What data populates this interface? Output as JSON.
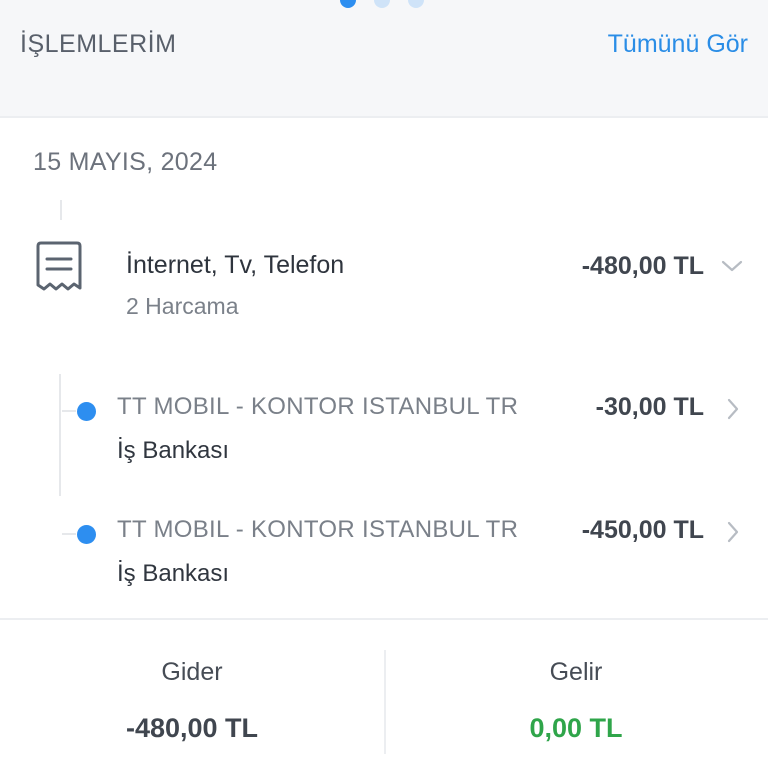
{
  "header": {
    "title": "İŞLEMLERİM",
    "see_all_label": "Tümünü Gör",
    "pager": {
      "count": 3,
      "active_index": 0
    }
  },
  "date": "15 MAYIS, 2024",
  "category": {
    "icon": "receipt-icon",
    "title": "İnternet, Tv, Telefon",
    "subtitle": "2 Harcama",
    "amount": "-480,00 TL",
    "expand_icon": "chevron-down-icon"
  },
  "transactions": [
    {
      "merchant": "TT MOBIL - KONTOR ISTANBUL TR",
      "bank": "İş Bankası",
      "amount": "-30,00 TL"
    },
    {
      "merchant": "TT MOBIL - KONTOR ISTANBUL TR",
      "bank": "İş Bankası",
      "amount": "-450,00 TL"
    }
  ],
  "summary": {
    "expense_label": "Gider",
    "expense_value": "-480,00 TL",
    "income_label": "Gelir",
    "income_value": "0,00 TL"
  },
  "colors": {
    "accent": "#2d8ef0",
    "expense_value": "#40464f",
    "income_value": "#2fa54a"
  }
}
